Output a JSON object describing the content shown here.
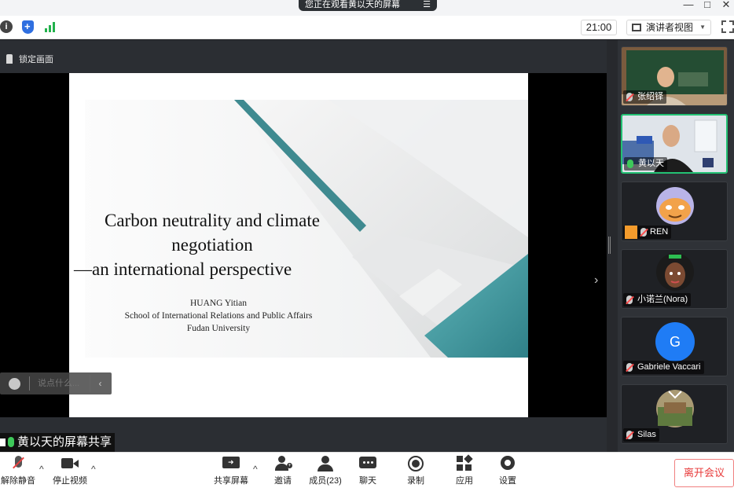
{
  "titlebar": {
    "share_notice": "您正在观看黄以天的屏幕",
    "share_menu_glyph": "☰",
    "minimize_glyph": "—",
    "restore_glyph": "□",
    "close_glyph": "✕"
  },
  "toolbar": {
    "info_glyph": "i",
    "clock": "21:00",
    "view_mode": "演讲者视图",
    "view_caret": "▼"
  },
  "main": {
    "lock_label": "锁定画面",
    "slide": {
      "title_line1": "Carbon neutrality and climate",
      "title_line2": "negotiation",
      "title_line3": "—an international perspective",
      "author": "HUANG Yitian",
      "school": "School of International Relations and Public Affairs",
      "university": "Fudan University"
    },
    "chat": {
      "placeholder": "说点什么...",
      "collapse_glyph": "‹"
    },
    "presenter_label": "黄以天的屏幕共享",
    "splitter_glyph": "›"
  },
  "participants": [
    {
      "name": "张绍铎",
      "mic": "off"
    },
    {
      "name": "黄以天",
      "mic": "on"
    },
    {
      "name": "REN",
      "mic": "off"
    },
    {
      "name": "小诺兰(Nora)",
      "mic": "off"
    },
    {
      "name": "Gabriele Vaccari",
      "mic": "off",
      "avatar_letter": "G"
    },
    {
      "name": "Silas",
      "mic": "off"
    }
  ],
  "controls": {
    "unmute": "解除静音",
    "stop_video": "停止视频",
    "share_screen": "共享屏幕",
    "invite": "邀请",
    "members": "成员(23)",
    "chat": "聊天",
    "record": "录制",
    "apps": "应用",
    "settings": "设置",
    "leave": "离开会议",
    "caret_glyph": "^"
  },
  "colors": {
    "accent_green": "#23c274",
    "leave_red": "#e83a3a",
    "slide_teal": "#3f9aa0",
    "avatar_blue": "#1f7cf5"
  }
}
